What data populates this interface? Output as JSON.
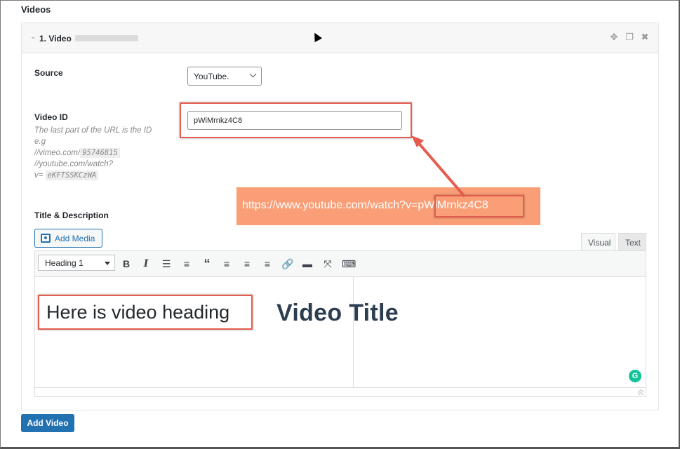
{
  "section": {
    "title": "Videos"
  },
  "panel": {
    "title": "1. Video",
    "icons": [
      "move-icon",
      "duplicate-icon",
      "close-icon"
    ]
  },
  "source": {
    "label": "Source",
    "selected": "YouTube."
  },
  "video_id": {
    "label": "Video ID",
    "value": "pWiMrnkz4C8",
    "hint_line1": "The last part of the URL is the ID e.g",
    "hint_vimeo_prefix": "//vimeo.com/",
    "hint_vimeo_code": "95746815",
    "hint_youtube_prefix": "//youtube.com/watch?",
    "hint_youtube_v": "v=",
    "hint_youtube_code": "eKFTSSKCzWA"
  },
  "annotation": {
    "url_prefix": "https://www.youtube.com/watch?v=",
    "url_id": "pWiMrnkz4C8",
    "accent_color": "#e35d4e",
    "box_color": "#f99e76"
  },
  "editor": {
    "section_label": "Title & Description",
    "add_media_label": "Add Media",
    "tab_visual": "Visual",
    "tab_text": "Text",
    "format_selected": "Heading 1",
    "heading_text": "Here is video heading",
    "overlay_title": "Video Title",
    "grammarly_letter": "G"
  },
  "add_video_label": "Add Video",
  "colors": {
    "primary": "#2271b1"
  }
}
